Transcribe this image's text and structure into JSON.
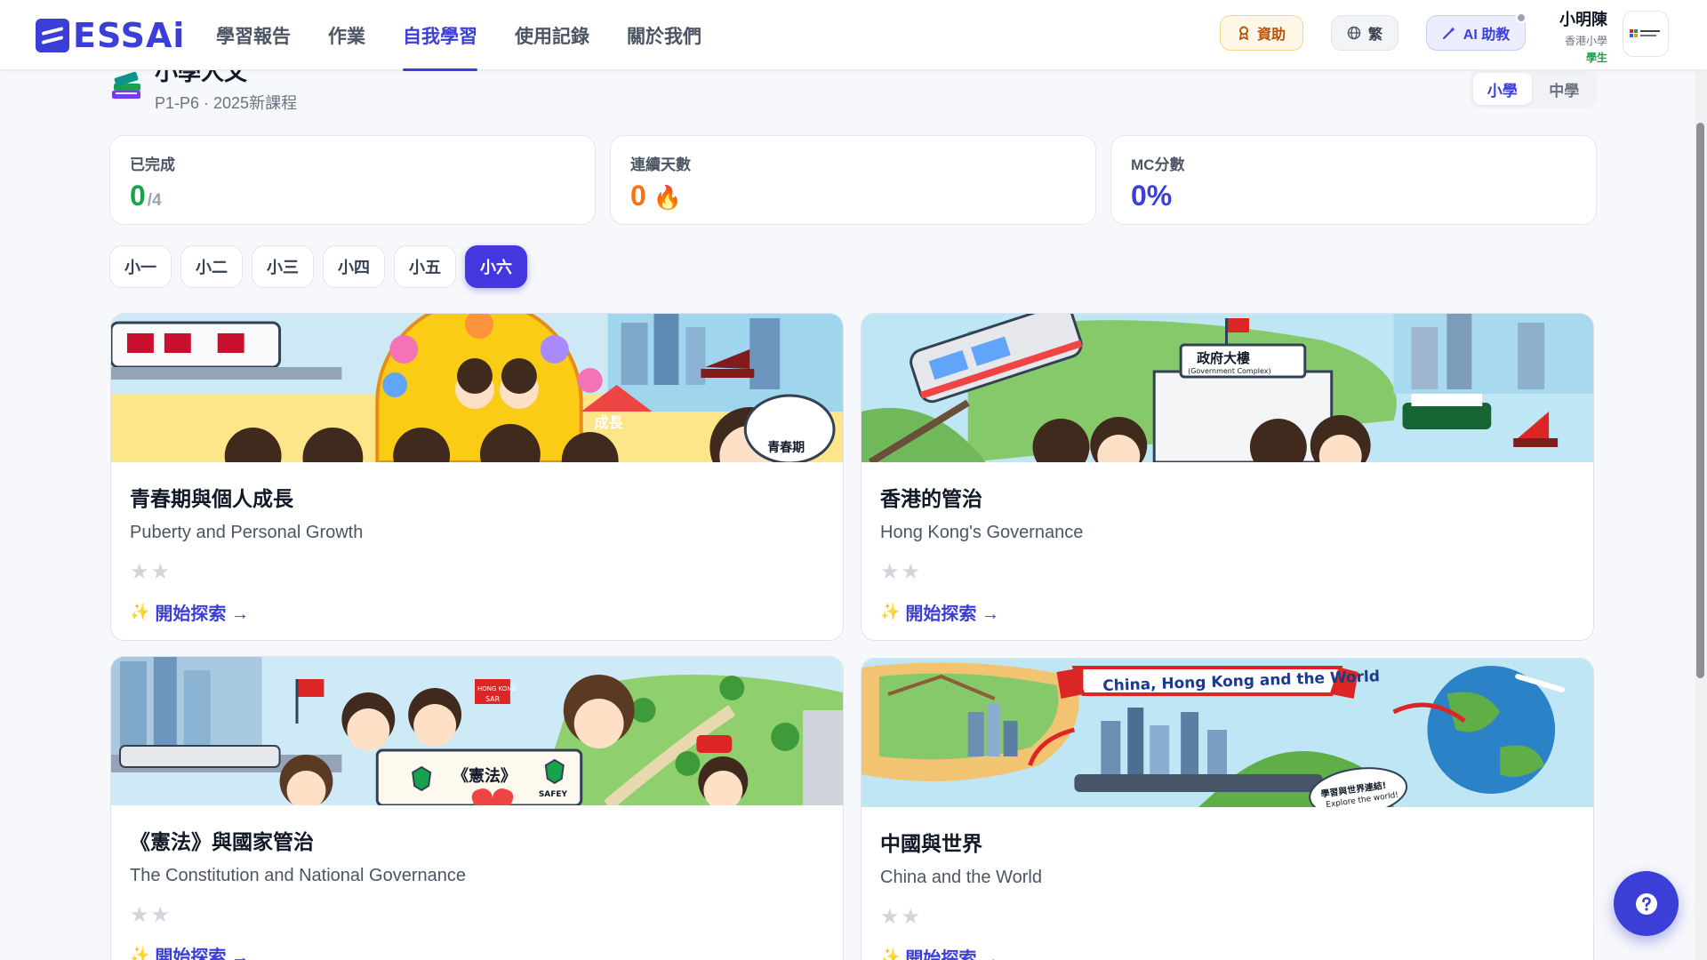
{
  "header": {
    "brand": "ESSAi",
    "nav": [
      {
        "label": "學習報告"
      },
      {
        "label": "作業"
      },
      {
        "label": "自我學習",
        "active": true
      },
      {
        "label": "使用記錄"
      },
      {
        "label": "關於我們"
      }
    ],
    "sponsor_label": "資助",
    "lang_label": "繁",
    "ai_label": "AI 助教",
    "user": {
      "name": "小明陳",
      "school": "香港小學",
      "role": "學生"
    },
    "icons": {
      "sponsor": "award-icon",
      "lang": "globe-icon",
      "ai": "magic-wand-icon"
    }
  },
  "page": {
    "title": "小學人文",
    "subtitle": "P1-P6 · 2025新課程",
    "level_tabs": [
      {
        "label": "小學",
        "active": true
      },
      {
        "label": "中學"
      }
    ]
  },
  "stats": [
    {
      "label": "已完成",
      "value": "0",
      "suffix": "/4",
      "color": "#16a34a"
    },
    {
      "label": "連續天數",
      "value": "0",
      "suffix": "🔥",
      "color": "#f97316"
    },
    {
      "label": "MC分數",
      "value": "0%",
      "suffix": "",
      "color": "#3b3fd8"
    }
  ],
  "grades": [
    {
      "label": "小一"
    },
    {
      "label": "小二"
    },
    {
      "label": "小三"
    },
    {
      "label": "小四"
    },
    {
      "label": "小五"
    },
    {
      "label": "小六",
      "active": true
    }
  ],
  "cards": [
    {
      "title": "青春期與個人成長",
      "subtitle": "Puberty and Personal Growth",
      "stars": "★★",
      "cta": "開始探索 →",
      "banner_texts": [
        "成長",
        "青春期"
      ]
    },
    {
      "title": "香港的管治",
      "subtitle": "Hong Kong's Governance",
      "stars": "★★",
      "cta": "開始探索 →",
      "banner_texts": [
        "政府大樓",
        "(Government Complex)"
      ]
    },
    {
      "title": "《憲法》與國家管治",
      "subtitle": "The Constitution and National Governance",
      "stars": "★★",
      "cta": "開始探索 →",
      "banner_texts": [
        "《憲法》",
        "HONG KONG",
        "SAR",
        "SAFEY"
      ]
    },
    {
      "title": "中國與世界",
      "subtitle": "China and the World",
      "stars": "★★",
      "cta": "開始探索 →",
      "banner_texts": [
        "China, Hong Kong and the World",
        "學習與世界連結!",
        "Explore the world!"
      ]
    }
  ],
  "colors": {
    "accent": "#3b3fd8",
    "accent_dark": "#4338e0"
  }
}
